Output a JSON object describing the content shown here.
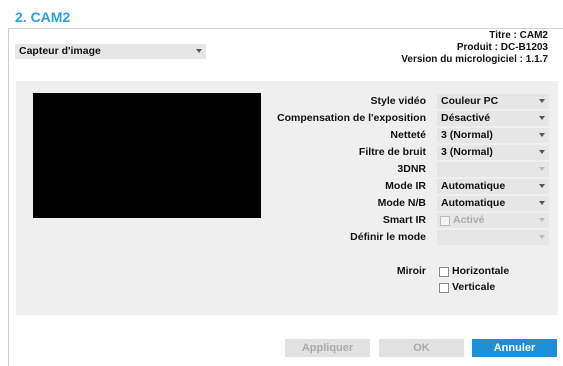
{
  "page": {
    "title": "2. CAM2"
  },
  "category": {
    "selected": "Capteur d'image"
  },
  "device_info": {
    "title": "Titre : CAM2",
    "product": "Produit : DC-B1203",
    "firmware": "Version du micrologiciel : 1.1.7"
  },
  "settings": {
    "video_style": {
      "label": "Style vidéo",
      "value": "Couleur PC"
    },
    "exposure": {
      "label": "Compensation de l'exposition",
      "value": "Désactivé"
    },
    "sharpness": {
      "label": "Netteté",
      "value": "3 (Normal)"
    },
    "noise_filter": {
      "label": "Filtre de bruit",
      "value": "3 (Normal)"
    },
    "dnr": {
      "label": "3DNR",
      "value": ""
    },
    "ir_mode": {
      "label": "Mode IR",
      "value": "Automatique"
    },
    "bw_mode": {
      "label": "Mode N/B",
      "value": "Automatique"
    },
    "smart_ir": {
      "label": "Smart IR",
      "value": "Activé"
    },
    "set_mode": {
      "label": "Définir le mode",
      "value": ""
    }
  },
  "mirror": {
    "label": "Miroir",
    "horizontal": "Horizontale",
    "vertical": "Verticale"
  },
  "buttons": {
    "apply": "Appliquer",
    "ok": "OK",
    "cancel": "Annuler"
  },
  "colors": {
    "accent": "#2aa0dd",
    "primary_button": "#1e8fd6"
  }
}
